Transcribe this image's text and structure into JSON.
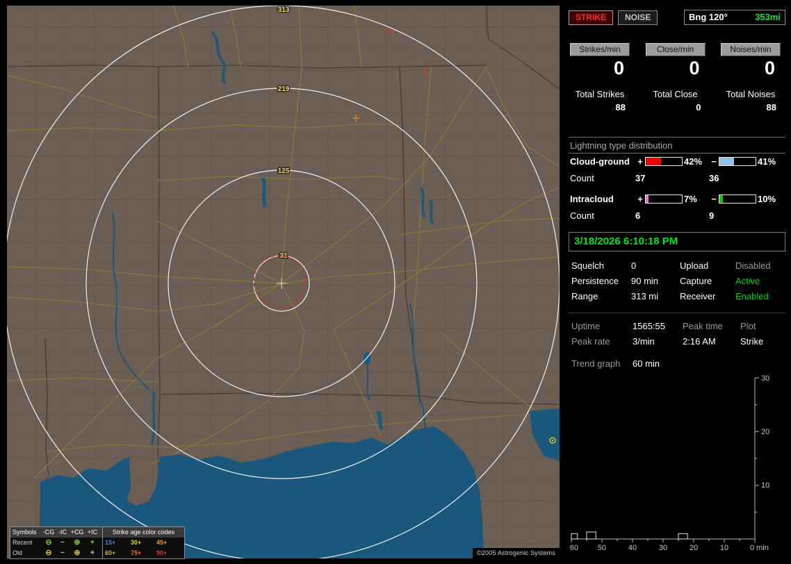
{
  "map": {
    "range_ring_labels": [
      "313",
      "219",
      "125",
      "31"
    ],
    "copyright": "©2005 Astrogenic Systems",
    "legend": {
      "symbols_header": "Symbols",
      "columns": [
        "-CG",
        "-IC",
        "+CG",
        "+IC"
      ],
      "age_header": "Strike age color codes",
      "recent": {
        "label": "Recent",
        "color": "#7cc838",
        "symbols": [
          "⊖",
          "−",
          "⊕",
          "+"
        ],
        "ages": [
          {
            "text": "15+",
            "color": "#5080f0"
          },
          {
            "text": "30+",
            "color": "#d8d038"
          },
          {
            "text": "45+",
            "color": "#e8a030"
          }
        ]
      },
      "old": {
        "label": "Old",
        "color": "#d8c830",
        "symbols": [
          "⊖",
          "−",
          "⊕",
          "+"
        ],
        "ages": [
          {
            "text": "60+",
            "color": "#d8a828"
          },
          {
            "text": "75+",
            "color": "#e87020"
          },
          {
            "text": "90+",
            "color": "#e83018"
          }
        ]
      }
    }
  },
  "panel": {
    "strike_button": "STRIKE",
    "noise_button": "NOISE",
    "bearing_label": "Bng 120°",
    "bearing_value": "353mi",
    "rate_boxes": [
      {
        "label": "Strikes/min",
        "value": "0",
        "total_label": "Total Strikes",
        "total": "88"
      },
      {
        "label": "Close/min",
        "value": "0",
        "total_label": "Total Close",
        "total": "0"
      },
      {
        "label": "Noises/min",
        "value": "0",
        "total_label": "Total Noises",
        "total": "88"
      }
    ],
    "signs": {
      "plus": "+",
      "minus": "−"
    },
    "distribution": {
      "title": "Lightning type distribution",
      "rows": [
        {
          "label": "Cloud-ground",
          "plus_pct": "42%",
          "minus_pct": "41%",
          "plus_fill": 42,
          "minus_fill": 41,
          "plus_color": "#f20000",
          "minus_color": "#8fc0ee",
          "count_label": "Count",
          "plus_count": "37",
          "minus_count": "36"
        },
        {
          "label": "Intracloud",
          "plus_pct": "7%",
          "minus_pct": "10%",
          "plus_fill": 7,
          "minus_fill": 10,
          "plus_color": "#f070d0",
          "minus_color": "#00d000",
          "count_label": "Count",
          "plus_count": "6",
          "minus_count": "9"
        }
      ]
    },
    "datetime": "3/18/2026 6:10:18 PM",
    "settings": [
      {
        "label": "Squelch",
        "value": "0",
        "label2": "Upload",
        "value2": "Disabled",
        "value2_color": "#9a9a9a"
      },
      {
        "label": "Persistence",
        "value": "90 min",
        "label2": "Capture",
        "value2": "Active",
        "value2_color": "#00d020"
      },
      {
        "label": "Range",
        "value": "313 mi",
        "label2": "Receiver",
        "value2": "Enabled",
        "value2_color": "#00d020"
      }
    ],
    "stats": {
      "uptime_label": "Uptime",
      "uptime": "1565:55",
      "peak_time_label": "Peak time",
      "peak_time": "2:16 AM",
      "plot_label": "Plot",
      "plot": "Strike",
      "peak_rate_label": "Peak rate",
      "peak_rate": "3/min",
      "trend_label": "Trend graph",
      "trend_value": "60 min"
    },
    "trend_graph": {
      "type": "histogram",
      "y_max": 30,
      "x_range_minutes": 60,
      "y_ticks": [
        "30",
        "20",
        "10"
      ],
      "x_ticks": [
        "60",
        "50",
        "40",
        "30",
        "20",
        "10",
        "0 min"
      ],
      "bars": [
        {
          "start_min": 60,
          "end_min": 58,
          "count": 1
        },
        {
          "start_min": 55,
          "end_min": 52,
          "count": 1.3
        },
        {
          "start_min": 25,
          "end_min": 22,
          "count": 1
        }
      ]
    }
  }
}
